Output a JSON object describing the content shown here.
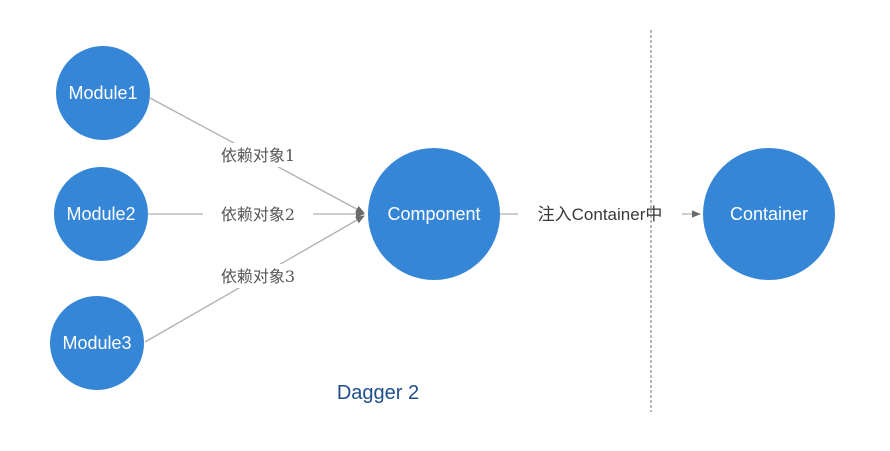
{
  "colors": {
    "node_fill": "#3586d6",
    "edge": "#b0b0b0",
    "divider": "#888888",
    "caption": "#1f4e8c"
  },
  "nodes": {
    "module1": "Module1",
    "module2": "Module2",
    "module3": "Module3",
    "component": "Component",
    "container": "Container"
  },
  "edges": {
    "dep1": "依赖对象1",
    "dep2": "依赖对象2",
    "dep3": "依赖对象3",
    "inject": "注入Container中"
  },
  "caption": "Dagger 2"
}
